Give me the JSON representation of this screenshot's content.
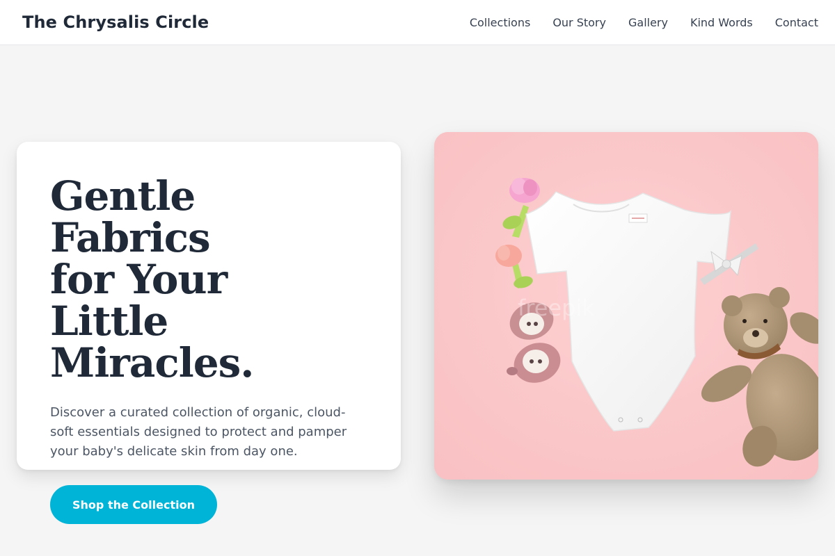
{
  "brand": {
    "name": "The Chrysalis Circle"
  },
  "nav": {
    "links": [
      "Collections",
      "Our Story",
      "Gallery",
      "Kind Words",
      "Contact"
    ]
  },
  "hero": {
    "headline_lines": [
      "Gentle Fabrics",
      "for Your Little",
      "Miracles."
    ],
    "subtext_lines": [
      "Discover a curated collection of organic, cloud-",
      "soft essentials designed to protect and pamper",
      "your baby's delicate skin from day one."
    ],
    "cta_label": "Shop the Collection"
  },
  "image": {
    "subject": "flat-lay of white baby bodysuit, pink booties, teethers, headband bow and teddy bear on pink background",
    "watermark": "freepik"
  },
  "colors": {
    "accent": "#00b4d8",
    "text_dark": "#1f2937",
    "text_muted": "#4b5563",
    "page_bg": "#f5f5f5",
    "image_bg": "#fcc9ca"
  }
}
